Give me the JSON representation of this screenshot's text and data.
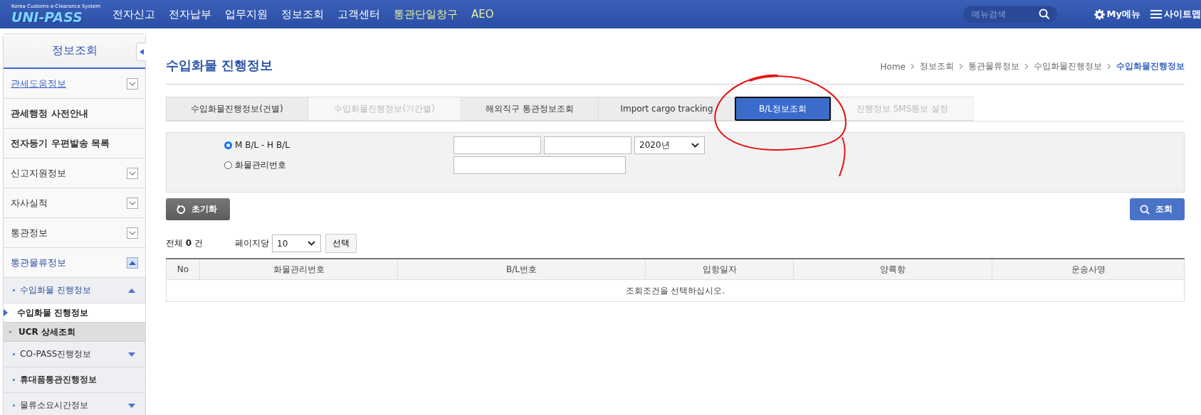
{
  "header": {
    "logo": {
      "tagline": "Korea Customs e-Clearance System",
      "name": "UNI-PASS"
    },
    "nav": [
      {
        "label": "전자신고",
        "highlight": false
      },
      {
        "label": "전자납부",
        "highlight": false
      },
      {
        "label": "업무지원",
        "highlight": false
      },
      {
        "label": "정보조회",
        "highlight": false
      },
      {
        "label": "고객센터",
        "highlight": false
      },
      {
        "label": "통관단일창구",
        "highlight": true
      },
      {
        "label": "AEO",
        "highlight": true
      }
    ],
    "search": {
      "placeholder": "메뉴검색"
    },
    "my_menu": "My메뉴",
    "sitemap": "사이트맵"
  },
  "sidebar": {
    "title": "정보조회",
    "items": [
      {
        "label": "관세도움정보",
        "kind": "link",
        "expanded": false
      },
      {
        "label": "관세행정 사전안내",
        "kind": "bold"
      },
      {
        "label": "전자등기 우편발송 목록",
        "kind": "bold"
      },
      {
        "label": "신고지원정보",
        "kind": "toggle",
        "expanded": false
      },
      {
        "label": "자사실적",
        "kind": "toggle",
        "expanded": false
      },
      {
        "label": "통관정보",
        "kind": "toggle",
        "expanded": false
      },
      {
        "label": "통관물류정보",
        "kind": "toggle",
        "expanded": true,
        "children": [
          {
            "label": "수입화물 진행정보",
            "kind": "toggle",
            "expanded": true,
            "children": [
              {
                "label": "수입화물 진행정보",
                "selected": true
              },
              {
                "label": "UCR 상세조회",
                "selected": false
              }
            ]
          },
          {
            "label": "CO-PASS진행정보",
            "kind": "toggle",
            "expanded": false
          },
          {
            "label": "휴대품통관진행정보",
            "kind": "bold"
          },
          {
            "label": "물류소요시간정보",
            "kind": "toggle",
            "expanded": false
          }
        ]
      }
    ]
  },
  "page": {
    "title": "수입화물 진행정보",
    "breadcrumb": [
      {
        "label": "Home",
        "current": false
      },
      {
        "label": "정보조회",
        "current": false
      },
      {
        "label": "통관물류정보",
        "current": false
      },
      {
        "label": "수입화물진행정보",
        "current": false
      },
      {
        "label": "수입화물진행정보",
        "current": true
      }
    ],
    "tabs": [
      {
        "label": "수입화물진행정보(건별)",
        "selected": false,
        "disabled": false
      },
      {
        "label": "수입화물진행정보(기간별)",
        "selected": false,
        "disabled": true
      },
      {
        "label": "해외직구 통관정보조회",
        "selected": false,
        "disabled": false
      },
      {
        "label": "Import cargo tracking",
        "selected": false,
        "disabled": false
      },
      {
        "label": "B/L정보조회",
        "selected": true,
        "disabled": false
      },
      {
        "label": "진행정보 SMS통보 설정",
        "selected": false,
        "disabled": true
      }
    ],
    "options": [
      {
        "label": "M B/L - H B/L",
        "selected": true
      },
      {
        "label": "화물관리번호",
        "selected": false
      }
    ],
    "year": "2020년",
    "reset_button": "초기화",
    "search_button": "조회",
    "total": {
      "prefix": "전체",
      "count": "0",
      "suffix": "건"
    },
    "per_page": {
      "label": "페이지당",
      "value": "10",
      "button": "선택"
    },
    "table": {
      "columns": [
        "No",
        "화물관리번호",
        "B/L번호",
        "입항일자",
        "양륙항",
        "운송사명"
      ],
      "empty": "조회조건을 선택하십시오."
    }
  }
}
